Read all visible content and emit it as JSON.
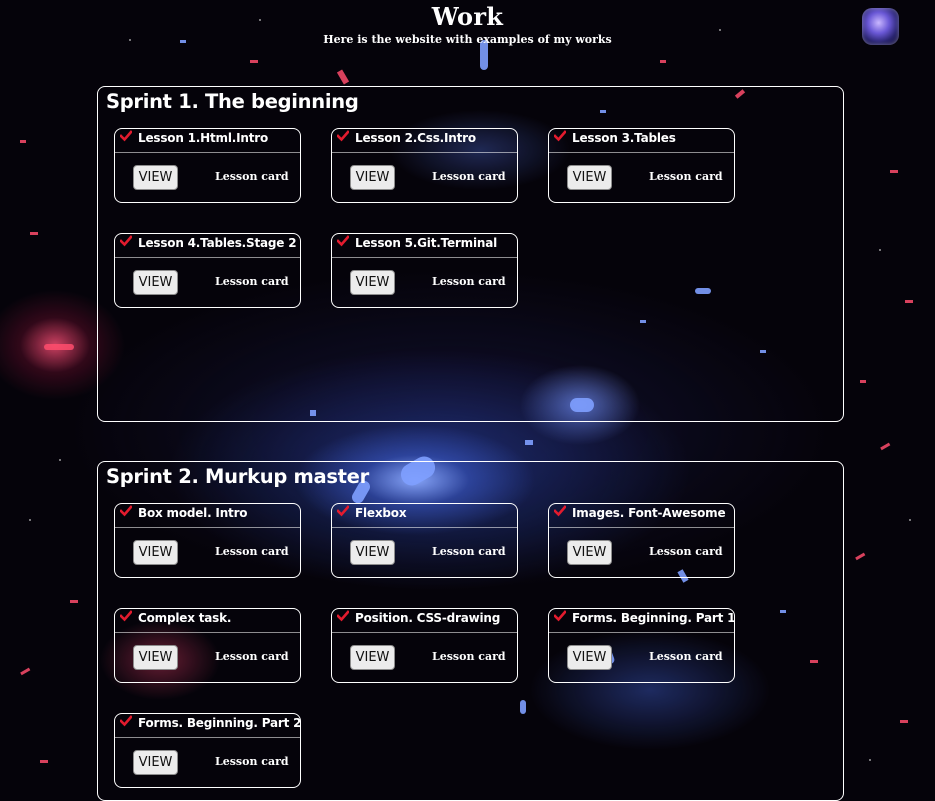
{
  "header": {
    "title": "Work",
    "subtitle": "Here is the website with examples of my works"
  },
  "colors": {
    "check_icon": "#e31b2e",
    "border": "#ffffff",
    "button_bg": "#ececec"
  },
  "sprints": [
    {
      "title": "Sprint 1. The beginning",
      "lessons": [
        {
          "title": "Lesson 1.Html.Intro",
          "button": "VIEW",
          "caption": "Lesson card"
        },
        {
          "title": "Lesson 2.Css.Intro",
          "button": "VIEW",
          "caption": "Lesson card"
        },
        {
          "title": "Lesson 3.Tables",
          "button": "VIEW",
          "caption": "Lesson card"
        },
        {
          "title": "Lesson 4.Tables.Stage 2",
          "button": "VIEW",
          "caption": "Lesson card"
        },
        {
          "title": "Lesson 5.Git.Terminal",
          "button": "VIEW",
          "caption": "Lesson card"
        }
      ]
    },
    {
      "title": "Sprint 2. Murkup master",
      "lessons": [
        {
          "title": "Box model. Intro",
          "button": "VIEW",
          "caption": "Lesson card"
        },
        {
          "title": "Flexbox",
          "button": "VIEW",
          "caption": "Lesson card"
        },
        {
          "title": "Images. Font-Awesome",
          "button": "VIEW",
          "caption": "Lesson card"
        },
        {
          "title": "Complex task.",
          "button": "VIEW",
          "caption": "Lesson card"
        },
        {
          "title": "Position. CSS-drawing",
          "button": "VIEW",
          "caption": "Lesson card"
        },
        {
          "title": "Forms. Beginning. Part 1",
          "button": "VIEW",
          "caption": "Lesson card"
        },
        {
          "title": "Forms. Beginning. Part 2",
          "button": "VIEW",
          "caption": "Lesson card"
        }
      ]
    }
  ]
}
